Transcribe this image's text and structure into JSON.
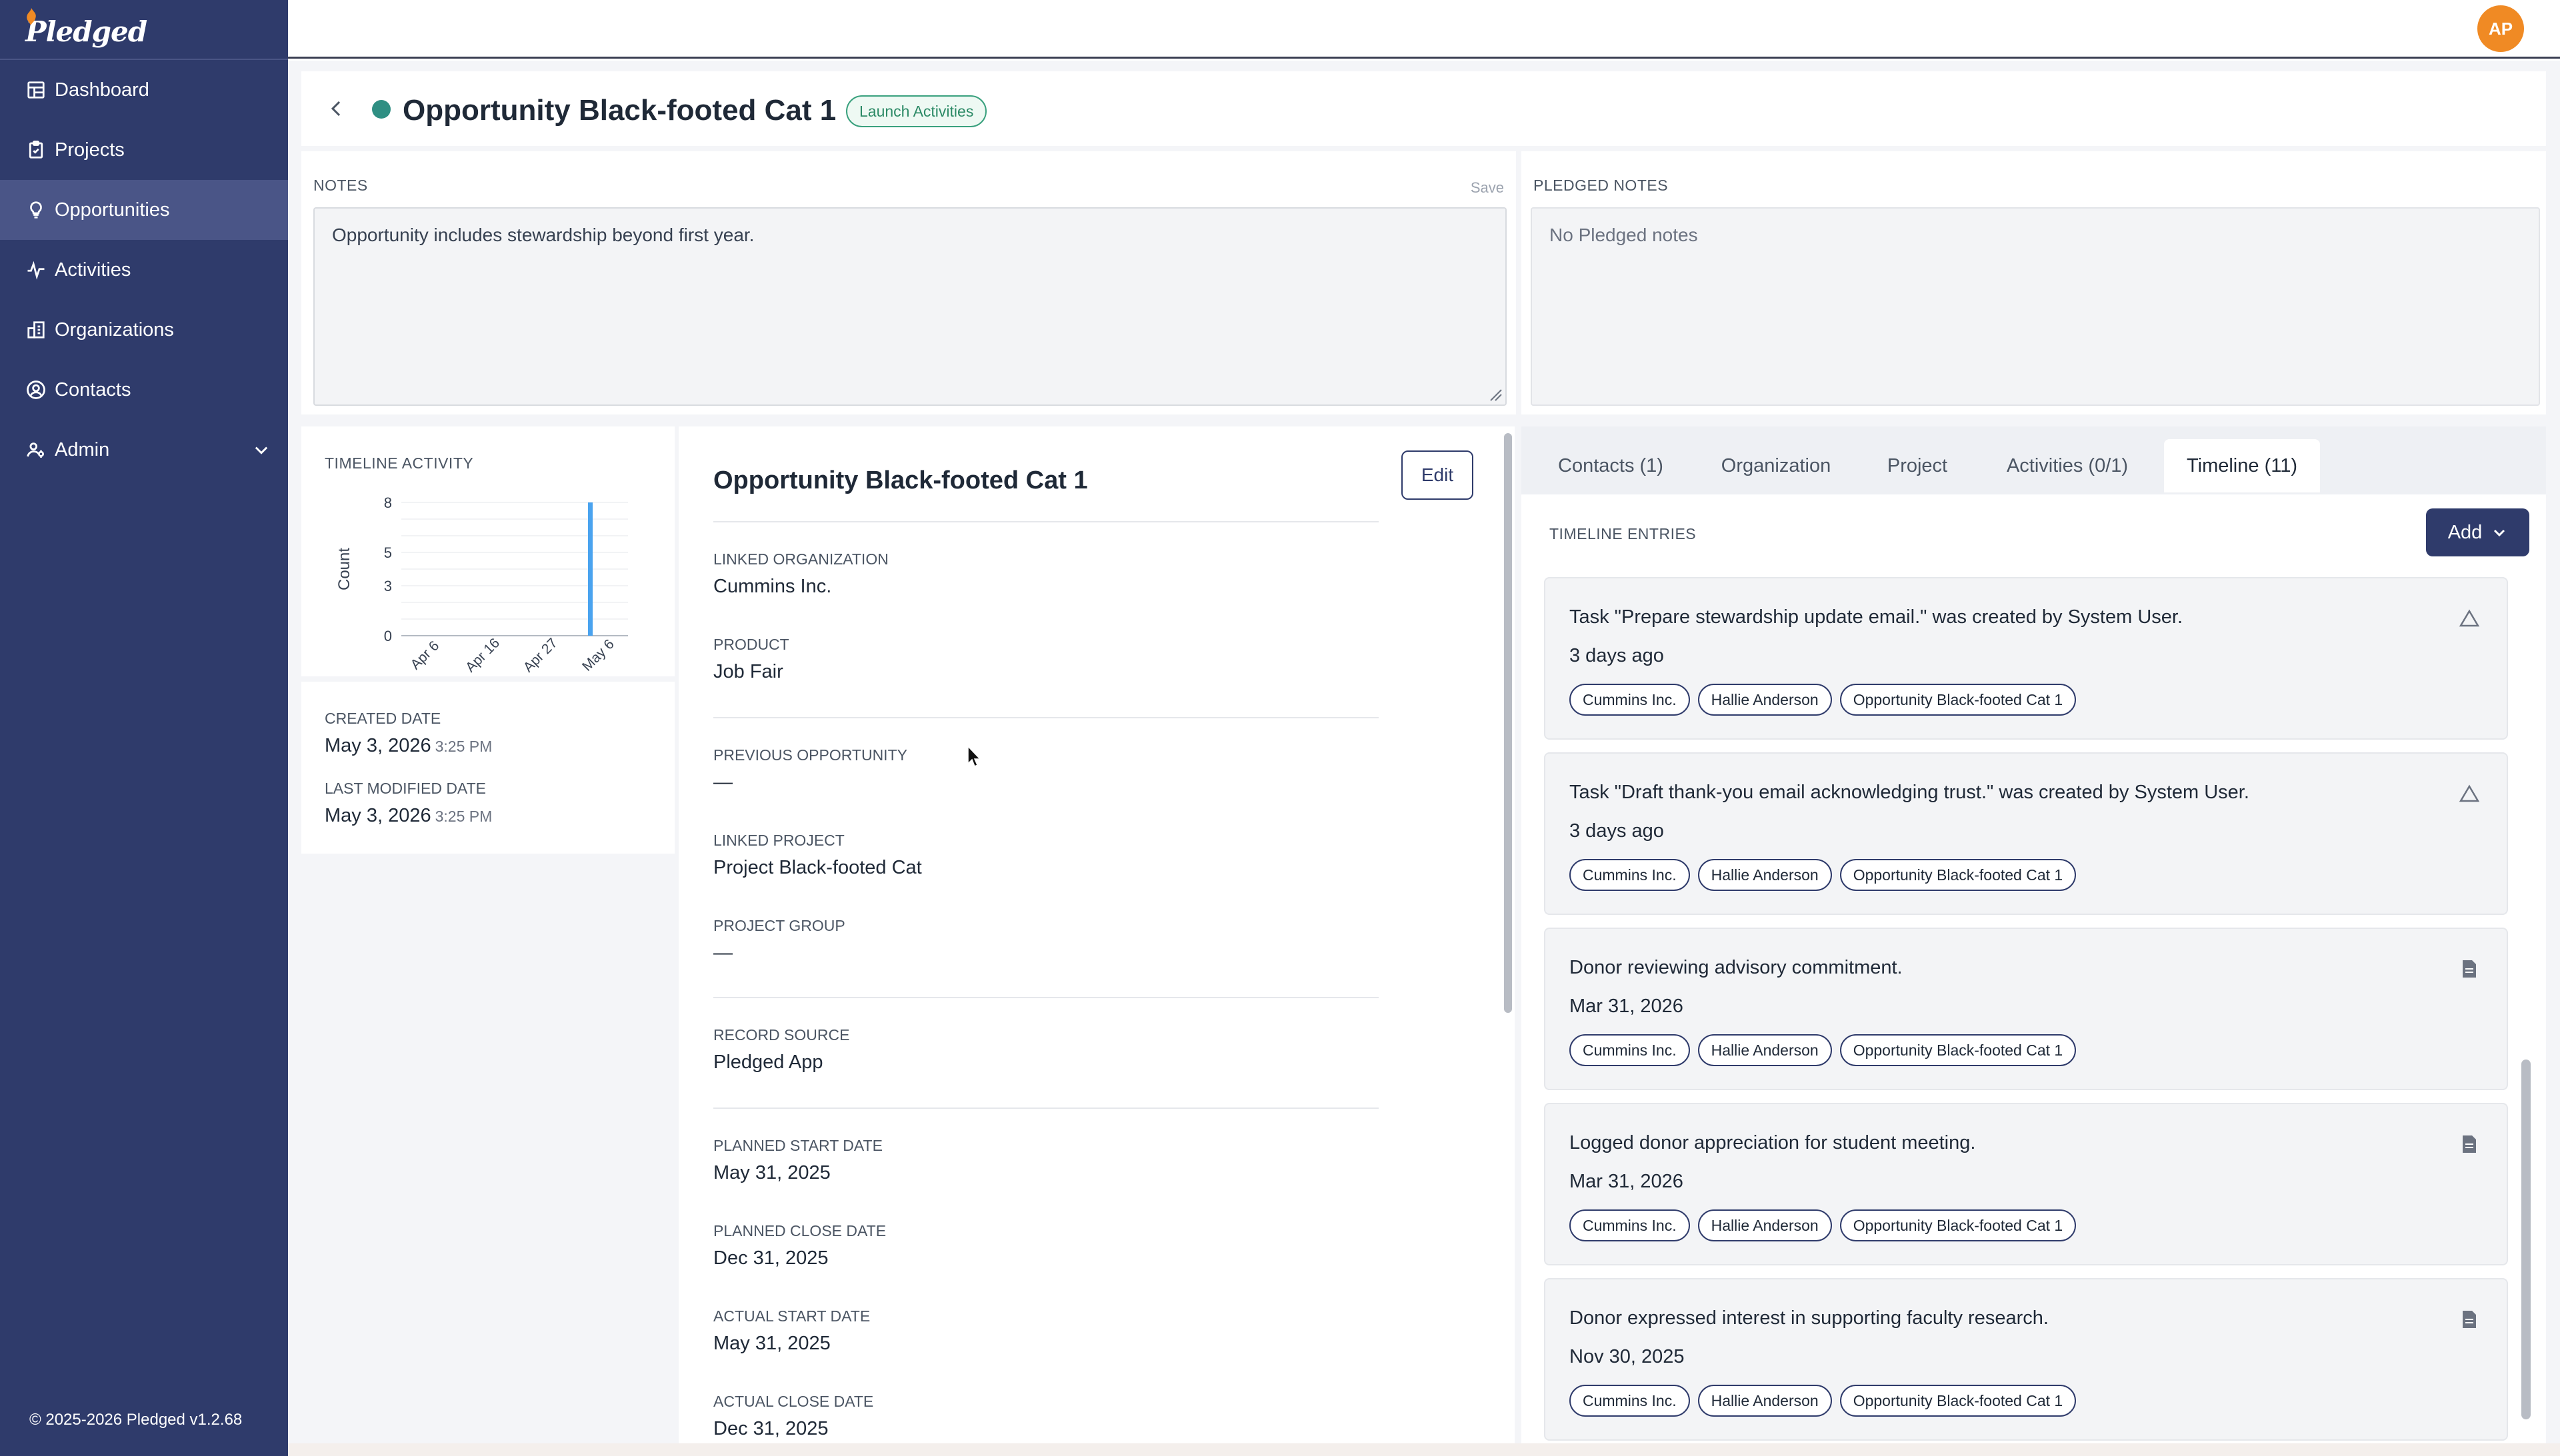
{
  "app": {
    "logo_text": "Pledged",
    "footer": "© 2025-2026 Pledged v1.2.68"
  },
  "sidebar": {
    "items": [
      {
        "label": "Dashboard",
        "icon": "dashboard-icon"
      },
      {
        "label": "Projects",
        "icon": "clipboard-icon"
      },
      {
        "label": "Opportunities",
        "icon": "lightbulb-icon",
        "active": true
      },
      {
        "label": "Activities",
        "icon": "activity-icon"
      },
      {
        "label": "Organizations",
        "icon": "building-icon"
      },
      {
        "label": "Contacts",
        "icon": "user-circle-icon"
      },
      {
        "label": "Admin",
        "icon": "users-gear-icon",
        "expandable": true
      }
    ]
  },
  "user": {
    "initials": "AP"
  },
  "header": {
    "title": "Opportunity Black-footed Cat 1",
    "badge": "Launch Activities",
    "status_color": "#2f8f83"
  },
  "notes": {
    "label": "NOTES",
    "save_label": "Save",
    "value": "Opportunity includes stewardship beyond first year."
  },
  "pledged_notes": {
    "label": "PLEDGED NOTES",
    "value": "No Pledged notes"
  },
  "timeline_activity": {
    "label": "TIMELINE ACTIVITY"
  },
  "chart_data": {
    "type": "bar",
    "ylabel": "Count",
    "xlabel": "",
    "ylim": [
      0,
      8
    ],
    "y_ticks": [
      "0",
      "3",
      "5",
      "8"
    ],
    "x_ticks": [
      "Apr 6",
      "Apr 16",
      "Apr 27",
      "May 6"
    ],
    "x_range": [
      "Apr 6",
      "May 8"
    ],
    "categories": [
      "May 3"
    ],
    "values": [
      8
    ],
    "color": "#4aa3ef",
    "grid": true
  },
  "dates": {
    "created_label": "CREATED DATE",
    "created_date": "May 3, 2026",
    "created_time": "3:25 PM",
    "modified_label": "LAST MODIFIED DATE",
    "modified_date": "May 3, 2026",
    "modified_time": "3:25 PM"
  },
  "details": {
    "title": "Opportunity Black-footed Cat 1",
    "edit_label": "Edit",
    "fields": [
      {
        "label": "LINKED ORGANIZATION",
        "value": "Cummins Inc."
      },
      {
        "label": "PRODUCT",
        "value": "Job Fair"
      },
      {
        "label": "PREVIOUS OPPORTUNITY",
        "value": "—"
      },
      {
        "label": "LINKED PROJECT",
        "value": "Project Black-footed Cat"
      },
      {
        "label": "PROJECT GROUP",
        "value": "—"
      },
      {
        "label": "RECORD SOURCE",
        "value": "Pledged App"
      },
      {
        "label": "PLANNED START DATE",
        "value": "May 31, 2025"
      },
      {
        "label": "PLANNED CLOSE DATE",
        "value": "Dec 31, 2025"
      },
      {
        "label": "ACTUAL START DATE",
        "value": "May 31, 2025"
      },
      {
        "label": "ACTUAL CLOSE DATE",
        "value": "Dec 31, 2025"
      }
    ]
  },
  "tabs": [
    {
      "label": "Contacts (1)"
    },
    {
      "label": "Organization"
    },
    {
      "label": "Project"
    },
    {
      "label": "Activities (0/1)"
    },
    {
      "label": "Timeline (11)",
      "active": true
    }
  ],
  "timeline": {
    "label": "TIMELINE ENTRIES",
    "add_label": "Add",
    "entries": [
      {
        "title": "Task \"Prepare stewardship update email.\" was created by System User.",
        "time": "3 days ago",
        "icon": "task-triangle-icon",
        "tags": [
          "Cummins Inc.",
          "Hallie Anderson",
          "Opportunity Black-footed Cat 1"
        ]
      },
      {
        "title": "Task \"Draft thank-you email acknowledging trust.\" was created by System User.",
        "time": "3 days ago",
        "icon": "task-triangle-icon",
        "tags": [
          "Cummins Inc.",
          "Hallie Anderson",
          "Opportunity Black-footed Cat 1"
        ]
      },
      {
        "title": "Donor reviewing advisory commitment.",
        "time": "Mar 31, 2026",
        "icon": "note-icon",
        "tags": [
          "Cummins Inc.",
          "Hallie Anderson",
          "Opportunity Black-footed Cat 1"
        ]
      },
      {
        "title": "Logged donor appreciation for student meeting.",
        "time": "Mar 31, 2026",
        "icon": "note-icon",
        "tags": [
          "Cummins Inc.",
          "Hallie Anderson",
          "Opportunity Black-footed Cat 1"
        ]
      },
      {
        "title": "Donor expressed interest in supporting faculty research.",
        "time": "Nov 30, 2025",
        "icon": "note-icon",
        "tags": [
          "Cummins Inc.",
          "Hallie Anderson",
          "Opportunity Black-footed Cat 1"
        ]
      }
    ]
  }
}
